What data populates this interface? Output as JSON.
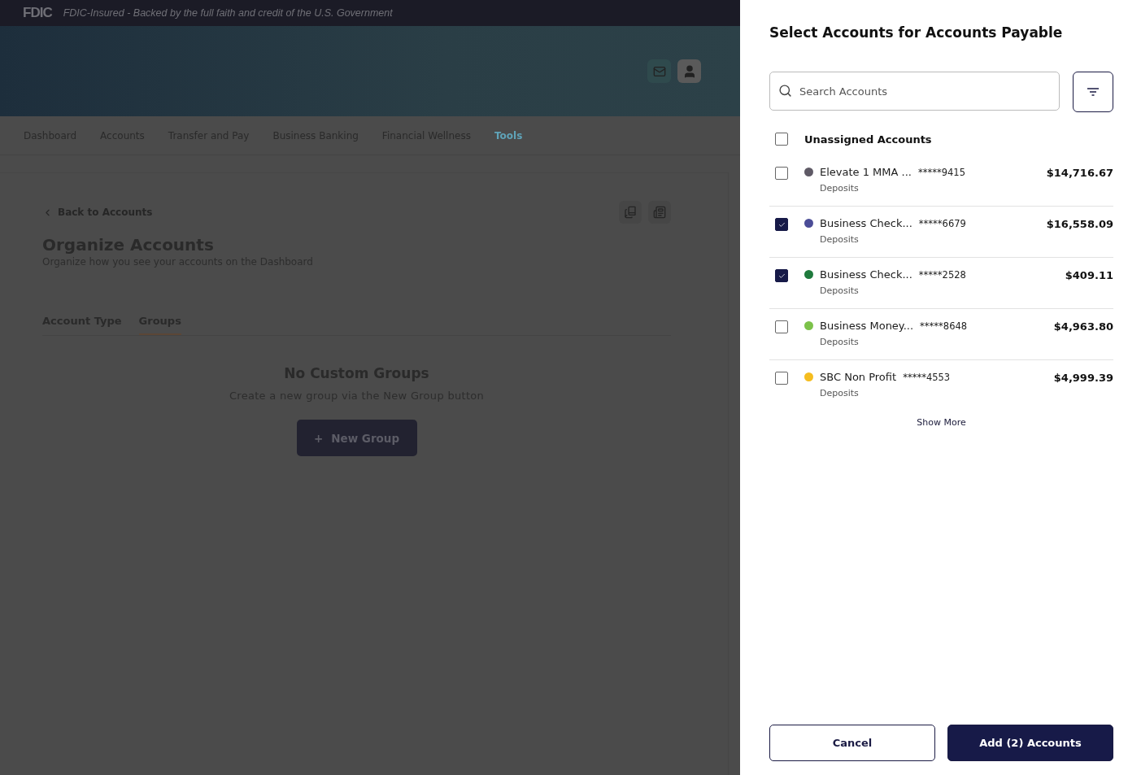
{
  "fdic_bar": {
    "logo": "FDIC",
    "notice": "FDIC-Insured - Backed by the full faith and credit of the U.S. Government"
  },
  "nav": [
    {
      "label": "Dashboard",
      "selected": false
    },
    {
      "label": "Accounts",
      "selected": false
    },
    {
      "label": "Transfer and Pay",
      "selected": false
    },
    {
      "label": "Business Banking",
      "selected": false
    },
    {
      "label": "Financial Wellness",
      "selected": false
    },
    {
      "label": "Tools",
      "selected": true
    }
  ],
  "page": {
    "back_link": "Back to Accounts",
    "title": "Organize Accounts",
    "subtitle": "Organize how you see your accounts on the Dashboard",
    "tabs": [
      {
        "label": "Account Type",
        "selected": false
      },
      {
        "label": "Groups",
        "selected": true
      }
    ],
    "empty_title": "No Custom Groups",
    "empty_text": "Create a new group via the New Group button",
    "new_group_button": {
      "icon": "+",
      "label": "New Group"
    }
  },
  "drawer": {
    "title": "Select Accounts for Accounts Payable",
    "search": {
      "placeholder": "Search Accounts"
    },
    "group": {
      "label": "Unassigned Accounts",
      "checked": false
    },
    "accounts": [
      {
        "name": "Elevate 1 MMA ...",
        "mask": "*****9415",
        "type": "Deposits",
        "amount": "$14,716.67",
        "checked": false,
        "color": "#5f5a66"
      },
      {
        "name": "Business Check...",
        "mask": "*****6679",
        "type": "Deposits",
        "amount": "$16,558.09",
        "checked": true,
        "color": "#4b4d97"
      },
      {
        "name": "Business Check...",
        "mask": "*****2528",
        "type": "Deposits",
        "amount": "$409.11",
        "checked": true,
        "color": "#1f7a3d"
      },
      {
        "name": "Business Money...",
        "mask": "*****8648",
        "type": "Deposits",
        "amount": "$4,963.80",
        "checked": false,
        "color": "#7cc24a"
      },
      {
        "name": "SBC Non Profit",
        "mask": "*****4553",
        "type": "Deposits",
        "amount": "$4,999.39",
        "checked": false,
        "color": "#f5bd1f"
      }
    ],
    "show_more": "Show More",
    "cancel": "Cancel",
    "submit": "Add (2) Accounts"
  }
}
